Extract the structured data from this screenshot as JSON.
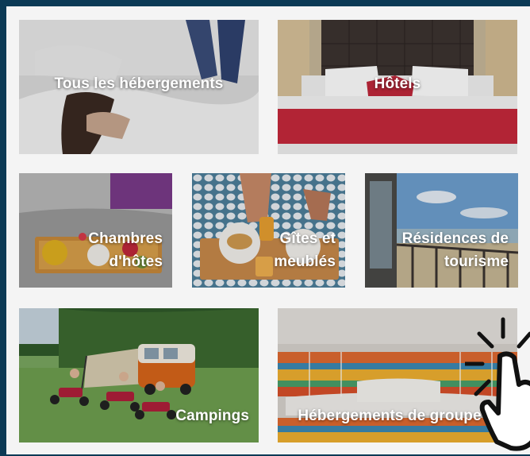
{
  "tiles": [
    {
      "id": "all",
      "label": "Tous les hébergements"
    },
    {
      "id": "hotels",
      "label": "Hôtels"
    },
    {
      "id": "chambres",
      "label_lines": [
        "Chambres",
        "d'hôtes"
      ]
    },
    {
      "id": "gites",
      "label_lines": [
        "Gîtes et",
        "meublés"
      ]
    },
    {
      "id": "residences",
      "label_lines": [
        "Résidences de",
        "tourisme"
      ]
    },
    {
      "id": "campings",
      "label": "Campings"
    },
    {
      "id": "groupes",
      "label": "Hébergements de groupe"
    }
  ],
  "colors": {
    "frame": "#0c3a55",
    "panel": "#f4f4f4",
    "label": "#ffffff"
  },
  "icons": [
    "pointer-hand-icon"
  ]
}
